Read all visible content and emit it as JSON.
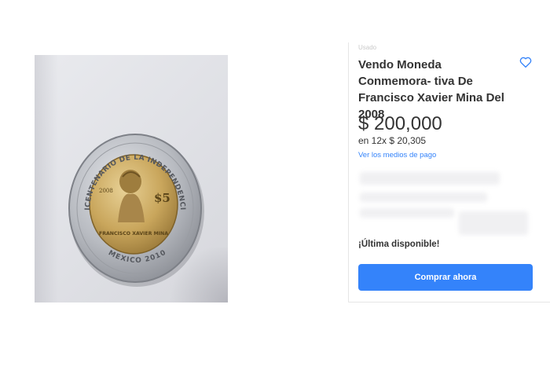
{
  "product": {
    "condition": "Usado",
    "title": "Vendo Moneda Conmemora- tiva De Francisco Xavier Mina Del 2008",
    "favorite_icon": "heart-outline-icon"
  },
  "price": {
    "amount": "$ 200,000",
    "installments": "en 12x $ 20,305",
    "payment_methods_link": "Ver los medios de pago"
  },
  "stock": {
    "label": "¡Última disponible!"
  },
  "actions": {
    "buy_now": "Comprar ahora"
  },
  "coin_image": {
    "ring_text_top": "BICENTENARIO DE LA INDEPENDENCIA",
    "ring_text_bottom": "MEXICO 2010",
    "center_name": "FRANCISCO XAVIER MINA",
    "denomination": "$5",
    "year": "2008"
  },
  "colors": {
    "accent": "#3483fa",
    "text": "#333333",
    "coin_ring": "#b9bcc2",
    "coin_center": "#c9a65c"
  }
}
